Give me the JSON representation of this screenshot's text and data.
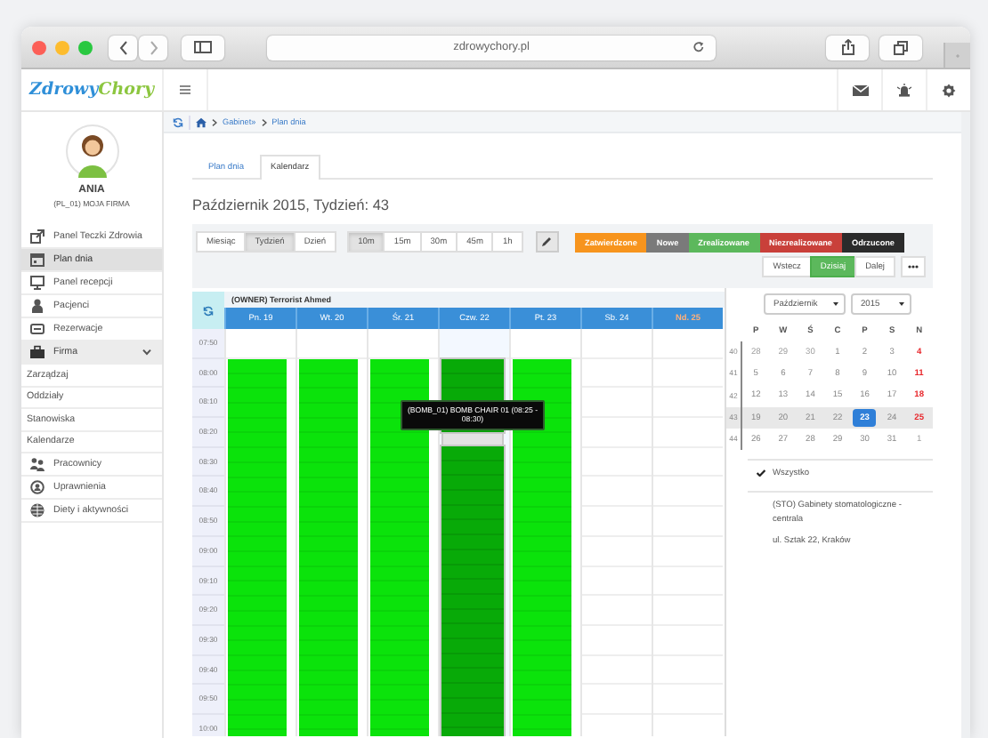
{
  "browser": {
    "url": "zdrowychory.pl"
  },
  "header": {
    "logo": [
      "Zdrowy",
      "Chory"
    ]
  },
  "user": {
    "name": "ANIA",
    "company": "(PL_01) MOJA FIRMA"
  },
  "sidebar": {
    "items": [
      {
        "label": "Panel Teczki Zdrowia",
        "selected": false
      },
      {
        "label": "Plan dnia",
        "selected": true
      },
      {
        "label": "Panel recepcji",
        "selected": false
      },
      {
        "label": "Pacjenci",
        "selected": false
      },
      {
        "label": "Rezerwacje",
        "selected": false
      },
      {
        "label": "Firma",
        "selected": false,
        "expanded": true,
        "children": [
          {
            "label": "Zarządzaj",
            "selected": false
          },
          {
            "label": "Oddziały",
            "selected": false
          },
          {
            "label": "Stanowiska",
            "selected": false
          },
          {
            "label": "Kalendarze",
            "selected": false
          }
        ]
      },
      {
        "label": "Pracownicy",
        "selected": false
      },
      {
        "label": "Uprawnienia",
        "selected": false
      },
      {
        "label": "Diety i aktywności",
        "selected": false
      }
    ]
  },
  "breadcrumb": [
    "Gabinet»",
    "Plan dnia"
  ],
  "tabs": [
    {
      "label": "Plan dnia",
      "selected": false
    },
    {
      "label": "Kalendarz",
      "selected": true
    }
  ],
  "title": "Październik 2015, Tydzień: 43",
  "view_buttons": [
    {
      "label": "Miesiąc",
      "selected": false
    },
    {
      "label": "Tydzień",
      "selected": true
    },
    {
      "label": "Dzień",
      "selected": false
    }
  ],
  "interval_buttons": [
    {
      "label": "10m",
      "selected": true
    },
    {
      "label": "15m",
      "selected": false
    },
    {
      "label": "30m",
      "selected": false
    },
    {
      "label": "45m",
      "selected": false
    },
    {
      "label": "1h",
      "selected": false
    }
  ],
  "legend": [
    {
      "label": "Zatwierdzone",
      "color": "#f7941d"
    },
    {
      "label": "Nowe",
      "color": "#7a7a7a"
    },
    {
      "label": "Zrealizowane",
      "color": "#5cb85c"
    },
    {
      "label": "Niezrealizowane",
      "color": "#c9403a"
    },
    {
      "label": "Odrzucone",
      "color": "#2b2b2b"
    }
  ],
  "nav_buttons": [
    {
      "label": "Wstecz",
      "kind": "default"
    },
    {
      "label": "Dzisiaj",
      "kind": "primary"
    },
    {
      "label": "Dalej",
      "kind": "default"
    }
  ],
  "calendar": {
    "owner": "(OWNER) Terrorist Ahmed",
    "days": [
      {
        "label": "Pn. 19",
        "holiday": false,
        "booked": true,
        "selected": false
      },
      {
        "label": "Wt. 20",
        "holiday": false,
        "booked": true,
        "selected": false
      },
      {
        "label": "Śr. 21",
        "holiday": false,
        "booked": true,
        "selected": false
      },
      {
        "label": "Czw. 22",
        "holiday": false,
        "booked": true,
        "selected": true,
        "tooltip": "(BOMB_01) BOMB CHAIR 01 (08:25 - 08:30)"
      },
      {
        "label": "Pt. 23",
        "holiday": false,
        "booked": true,
        "selected": false
      },
      {
        "label": "Sb. 24",
        "holiday": false,
        "booked": false,
        "selected": false
      },
      {
        "label": "Nd. 25",
        "holiday": true,
        "booked": false,
        "selected": false
      }
    ],
    "times": [
      "07:50",
      "08:00",
      "08:10",
      "08:20",
      "08:30",
      "08:40",
      "08:50",
      "09:00",
      "09:10",
      "09:20",
      "09:30",
      "09:40",
      "09:50",
      "10:00"
    ]
  },
  "mini_calendar": {
    "month": "Październik",
    "year": "2015",
    "weekdays": [
      "P",
      "W",
      "Ś",
      "C",
      "P",
      "S",
      "N"
    ],
    "weeks": [
      {
        "number": "40",
        "selected": false,
        "days": [
          {
            "label": "28",
            "outside": true,
            "selected": false,
            "holiday": false
          },
          {
            "label": "29",
            "outside": true,
            "selected": false,
            "holiday": false
          },
          {
            "label": "30",
            "outside": true,
            "selected": false,
            "holiday": false
          },
          {
            "label": "1",
            "outside": false,
            "selected": false,
            "holiday": false
          },
          {
            "label": "2",
            "outside": false,
            "selected": false,
            "holiday": false
          },
          {
            "label": "3",
            "outside": false,
            "selected": false,
            "holiday": false
          },
          {
            "label": "4",
            "outside": false,
            "selected": false,
            "holiday": true
          }
        ]
      },
      {
        "number": "41",
        "selected": false,
        "days": [
          {
            "label": "5",
            "outside": false,
            "selected": false,
            "holiday": false
          },
          {
            "label": "6",
            "outside": false,
            "selected": false,
            "holiday": false
          },
          {
            "label": "7",
            "outside": false,
            "selected": false,
            "holiday": false
          },
          {
            "label": "8",
            "outside": false,
            "selected": false,
            "holiday": false
          },
          {
            "label": "9",
            "outside": false,
            "selected": false,
            "holiday": false
          },
          {
            "label": "10",
            "outside": false,
            "selected": false,
            "holiday": false
          },
          {
            "label": "11",
            "outside": false,
            "selected": false,
            "holiday": true
          }
        ]
      },
      {
        "number": "42",
        "selected": false,
        "days": [
          {
            "label": "12",
            "outside": false,
            "selected": false,
            "holiday": false
          },
          {
            "label": "13",
            "outside": false,
            "selected": false,
            "holiday": false
          },
          {
            "label": "14",
            "outside": false,
            "selected": false,
            "holiday": false
          },
          {
            "label": "15",
            "outside": false,
            "selected": false,
            "holiday": false
          },
          {
            "label": "16",
            "outside": false,
            "selected": false,
            "holiday": false
          },
          {
            "label": "17",
            "outside": false,
            "selected": false,
            "holiday": false
          },
          {
            "label": "18",
            "outside": false,
            "selected": false,
            "holiday": true
          }
        ]
      },
      {
        "number": "43",
        "selected": true,
        "days": [
          {
            "label": "19",
            "outside": false,
            "selected": false,
            "holiday": false
          },
          {
            "label": "20",
            "outside": false,
            "selected": false,
            "holiday": false
          },
          {
            "label": "21",
            "outside": false,
            "selected": false,
            "holiday": false
          },
          {
            "label": "22",
            "outside": false,
            "selected": false,
            "holiday": false
          },
          {
            "label": "23",
            "outside": false,
            "selected": true,
            "holiday": false
          },
          {
            "label": "24",
            "outside": false,
            "selected": false,
            "holiday": false
          },
          {
            "label": "25",
            "outside": false,
            "selected": false,
            "holiday": true
          }
        ]
      },
      {
        "number": "44",
        "selected": false,
        "days": [
          {
            "label": "26",
            "outside": false,
            "selected": false,
            "holiday": false
          },
          {
            "label": "27",
            "outside": false,
            "selected": false,
            "holiday": false
          },
          {
            "label": "28",
            "outside": false,
            "selected": false,
            "holiday": false
          },
          {
            "label": "29",
            "outside": false,
            "selected": false,
            "holiday": false
          },
          {
            "label": "30",
            "outside": false,
            "selected": false,
            "holiday": false
          },
          {
            "label": "31",
            "outside": false,
            "selected": false,
            "holiday": false
          },
          {
            "label": "1",
            "outside": true,
            "selected": false,
            "holiday": false
          }
        ]
      }
    ]
  },
  "filters": [
    {
      "label": "Wszystko",
      "checked": true
    },
    {
      "label": "(STO) Gabinety stomatologiczne - centrala",
      "address": "ul. Sztak 22, Kraków",
      "checked": false
    }
  ]
}
